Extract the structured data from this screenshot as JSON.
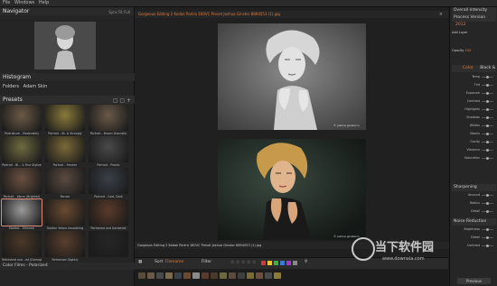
{
  "menubar": {
    "items": [
      "File",
      "Windows",
      "Help"
    ]
  },
  "navigator": {
    "title": "Navigator",
    "controls": [
      "Sync",
      "Fit",
      "Full"
    ]
  },
  "histogram": {
    "title": "Histogram"
  },
  "folders": {
    "tab1": "Folders",
    "tab2": "Adam Skin"
  },
  "presets": {
    "title": "Presets",
    "tiles": [
      {
        "label": "Portraiture - Moderately",
        "tone": "#6b5a45"
      },
      {
        "label": "Portrait - Bt. & Strongly",
        "tone": "#8a7a3a"
      },
      {
        "label": "Portrait - Brown Dramatic",
        "tone": "#6a5a48"
      },
      {
        "label": "Portrait - Bl... & Fine Stylize",
        "tone": "#6e6a40"
      },
      {
        "label": "Portrait - Fresher",
        "tone": "#7a6a38"
      },
      {
        "label": "Portrait - Plastic",
        "tone": "#4a4a4a"
      },
      {
        "label": "Portrait - Warm (Brighter)",
        "tone": "#6a5040"
      },
      {
        "label": "Ponzer",
        "tone": "#5a4a40"
      },
      {
        "label": "Portrait - Cool, Dark",
        "tone": "#3a4048"
      },
      {
        "label": "Modest - Ethereal",
        "tone": "#9a9a9a"
      },
      {
        "label": "Golden Yellow Smoothing",
        "tone": "#6a4a30"
      },
      {
        "label": "Portraved and Darkened",
        "tone": "#5a3a2a"
      },
      {
        "label": "Refreshed and ..ed (Damaged)",
        "tone": "#4a3828"
      },
      {
        "label": "Refreshed Slightly",
        "tone": "#5a3e2e"
      },
      {
        "label": "",
        "tone": "#262626"
      }
    ],
    "color_filter": "Color Films - Polarized"
  },
  "editor": {
    "tab_title": "Gorgeous Editing 2 Kodak Portra 160VC Preset Joshua Ginster 8894553 (1).jpg",
    "caption_top": "© joshua ginsterco",
    "caption_bottom": "© joshua ginsterco",
    "status": "Gorgeous Editing 2 Kodak Portra 160VC Preset Joshua Ginster 8894553 (1).jpg",
    "sort_label": "Sort",
    "sort_value": "Filename",
    "filter_label": "Filter"
  },
  "right_panel": {
    "top1": "Overall Intensity",
    "top2": "Process Version",
    "top2_val": "2012",
    "add_layer": "Add Layer",
    "opacity_label": "Opacity",
    "opacity_val": "100",
    "color_tab": "Color",
    "bw_tab": "Black &",
    "sliders": [
      "Temp",
      "Tint",
      "Exposure",
      "Contrast",
      "Highlights",
      "Shadows",
      "Whites",
      "Blacks",
      "Clarity",
      "Vibrance",
      "Saturation"
    ],
    "sharpening": "Sharpening",
    "sharp_sliders": [
      "Amount",
      "Radius",
      "Detail",
      "Masking"
    ],
    "noise": "Noise Reduction",
    "noise_sliders": [
      "Brightness",
      "Detail",
      "Contrast"
    ],
    "previous": "Previous"
  },
  "watermark": {
    "text": "当下软件园",
    "url": "www.downxia.com"
  },
  "colors": {
    "accent_orange": "#e07a3a",
    "selection": "#e08a7a"
  },
  "swatches": [
    "#d23a3a",
    "#e6c43a",
    "#3ab53a",
    "#3a7ad2",
    "#a03ad2",
    "#888888"
  ]
}
